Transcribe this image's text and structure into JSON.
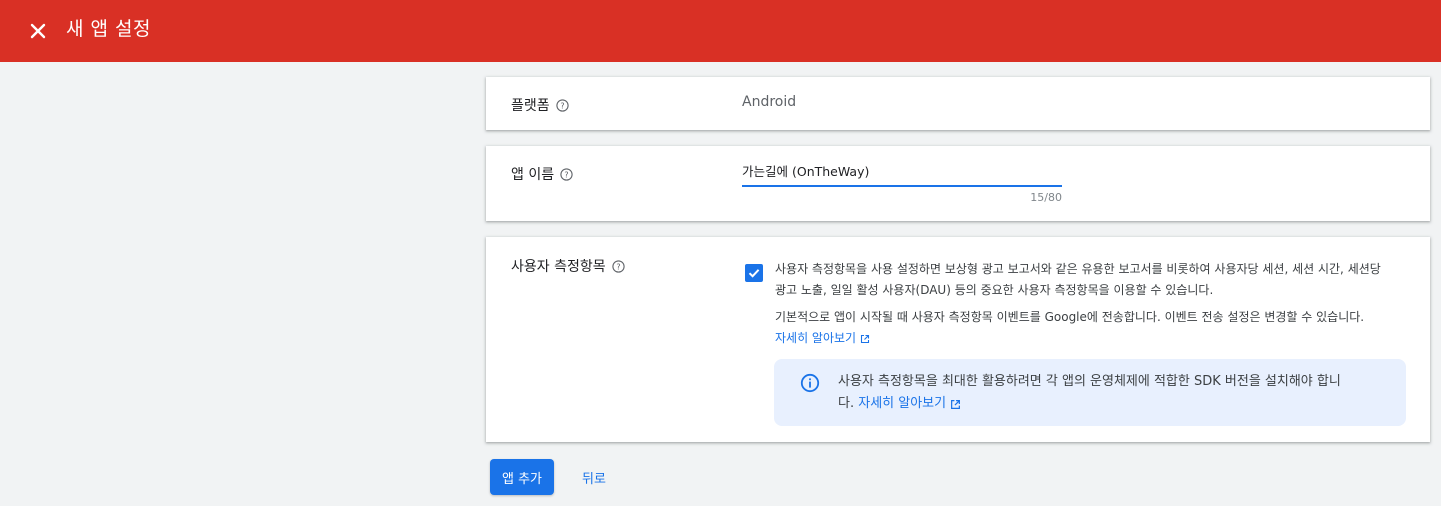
{
  "header": {
    "title": "새 앱 설정",
    "background_color": "#d93025",
    "close_icon": "close-icon"
  },
  "platform": {
    "label": "플랫폼",
    "value": "Android",
    "help_icon": "help-icon"
  },
  "app_name": {
    "label": "앱 이름",
    "value": "가는길에 (OnTheWay)",
    "counter": "15/80",
    "help_icon": "help-icon"
  },
  "user_metrics": {
    "label": "사용자 측정항목",
    "checked": true,
    "description": "사용자 측정항목을 사용 설정하면 보상형 광고 보고서와 같은 유용한 보고서를 비롯하여 사용자당 세션, 세션 시간, 세션당 광고 노출, 일일 활성 사용자(DAU) 등의 중요한 사용자 측정항목을 이용할 수 있습니다.",
    "default_note": "기본적으로 앱이 시작될 때 사용자 측정항목 이벤트를 Google에 전송합니다. 이벤트 전송 설정은 변경할 수 있습니다.",
    "learn_more": "자세히 알아보기",
    "info_text": "사용자 측정항목을 최대한 활용하려면 각 앱의 운영체제에 적합한 SDK 버전을 설치해야 합니다.",
    "info_learn_more": "자세히 알아보기",
    "info_icon": "info-icon"
  },
  "actions": {
    "add_app": "앱 추가",
    "back": "뒤로"
  },
  "colors": {
    "accent": "#1a73e8",
    "info_bg": "#e8f0fe"
  }
}
